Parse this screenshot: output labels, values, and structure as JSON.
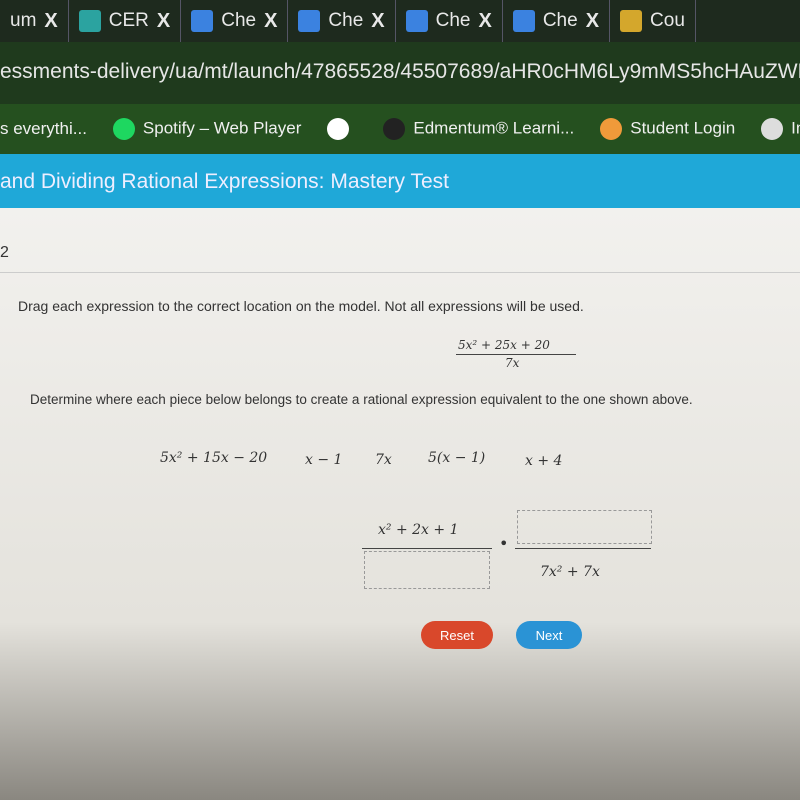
{
  "browser": {
    "tabs": [
      {
        "label": "um",
        "icon": "tab-icon",
        "color": "#1e2a1e"
      },
      {
        "label": "CER",
        "icon": "classroom-icon",
        "color": "#2ba3a0"
      },
      {
        "label": "Che",
        "icon": "docs-icon",
        "color": "#3b82e0"
      },
      {
        "label": "Che",
        "icon": "docs-icon",
        "color": "#3b82e0"
      },
      {
        "label": "Che",
        "icon": "docs-icon",
        "color": "#3b82e0"
      },
      {
        "label": "Che",
        "icon": "docs-icon",
        "color": "#3b82e0"
      },
      {
        "label": "Cou",
        "icon": "classroom-icon",
        "color": "#d4a72c"
      }
    ],
    "close_glyph": "X",
    "url": "essments-delivery/ua/mt/launch/47865528/45507689/aHR0cHM6Ly9mMS5hcHAuZWR",
    "bookmarks": [
      {
        "label": "s everythi...",
        "icon": "",
        "color": ""
      },
      {
        "label": "Spotify – Web Player",
        "icon": "spotify-icon",
        "color": "#1ed760"
      },
      {
        "label": "",
        "icon": "google-icon",
        "color": "#ffffff"
      },
      {
        "label": "Edmentum® Learni...",
        "icon": "edmentum-icon",
        "color": "#222222"
      },
      {
        "label": "Student Login",
        "icon": "student-login-icon",
        "color": "#f09a3a"
      },
      {
        "label": "Im",
        "icon": "folder-icon",
        "color": "#dddddd"
      }
    ]
  },
  "header": {
    "title": "and Dividing Rational Expressions: Mastery Test",
    "color": "#1fa8d8"
  },
  "question": {
    "number": "2",
    "instruction": "Drag each expression to the correct location on the model. Not all expressions will be used.",
    "target_numerator": "5x² + 25x + 20",
    "target_denominator": "7x",
    "prompt": "Determine where each piece below belongs to create a rational expression equivalent to the one shown above.",
    "pieces": [
      "5x² + 15x − 20",
      "x − 1",
      "7x",
      "5(x − 1)",
      "x + 4"
    ],
    "model": {
      "left_numerator": "x² + 2x + 1",
      "operator": "•",
      "right_denominator": "7x² + 7x"
    }
  },
  "buttons": {
    "reset": "Reset",
    "next": "Next",
    "reset_color": "#d9482b",
    "next_color": "#2a93d5"
  }
}
